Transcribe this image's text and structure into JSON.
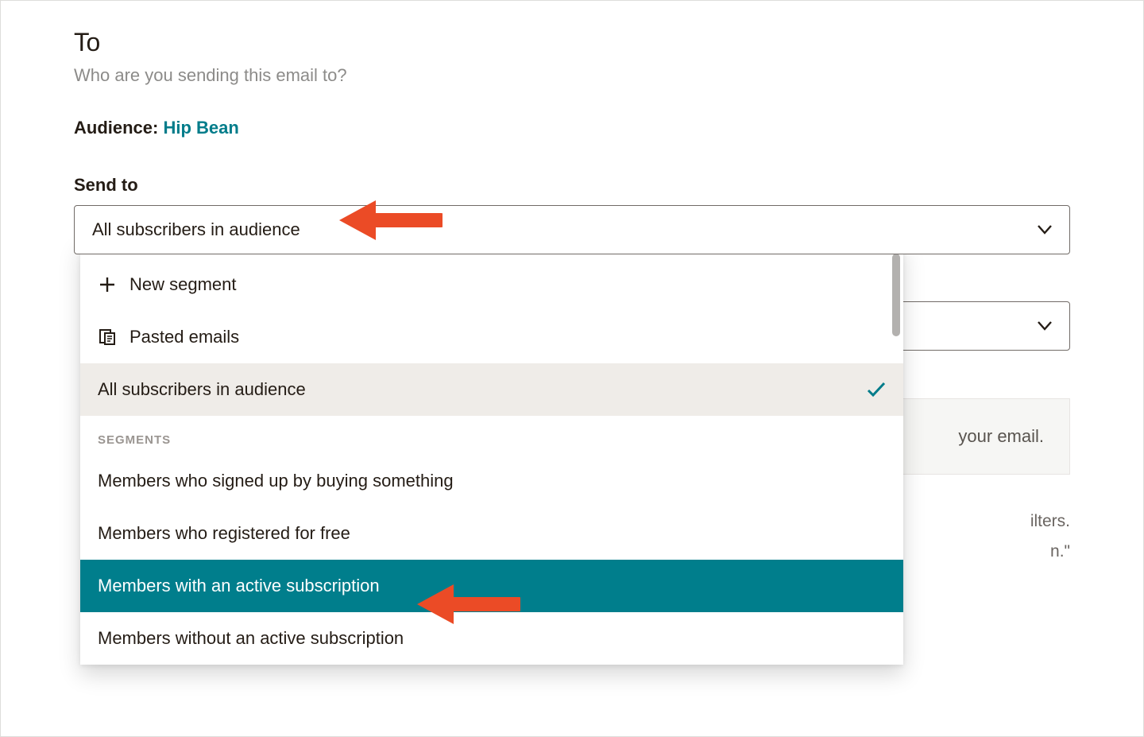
{
  "header": {
    "title": "To",
    "subtitle": "Who are you sending this email to?",
    "audience_label": "Audience: ",
    "audience_value": "Hip Bean"
  },
  "send_to": {
    "label": "Send to",
    "selected": "All subscribers in audience"
  },
  "dropdown": {
    "actions": [
      {
        "icon": "plus",
        "label": "New segment"
      },
      {
        "icon": "paste",
        "label": "Pasted emails"
      }
    ],
    "current": "All subscribers in audience",
    "group_label": "SEGMENTS",
    "segments": [
      {
        "label": "Members who signed up by buying something",
        "highlight": false
      },
      {
        "label": "Members who registered for free",
        "highlight": false
      },
      {
        "label": "Members with an active subscription",
        "highlight": true
      },
      {
        "label": "Members without an active subscription",
        "highlight": false
      }
    ]
  },
  "background": {
    "panel_text": "your email.",
    "line1": "ilters.",
    "line2": "n.\""
  }
}
